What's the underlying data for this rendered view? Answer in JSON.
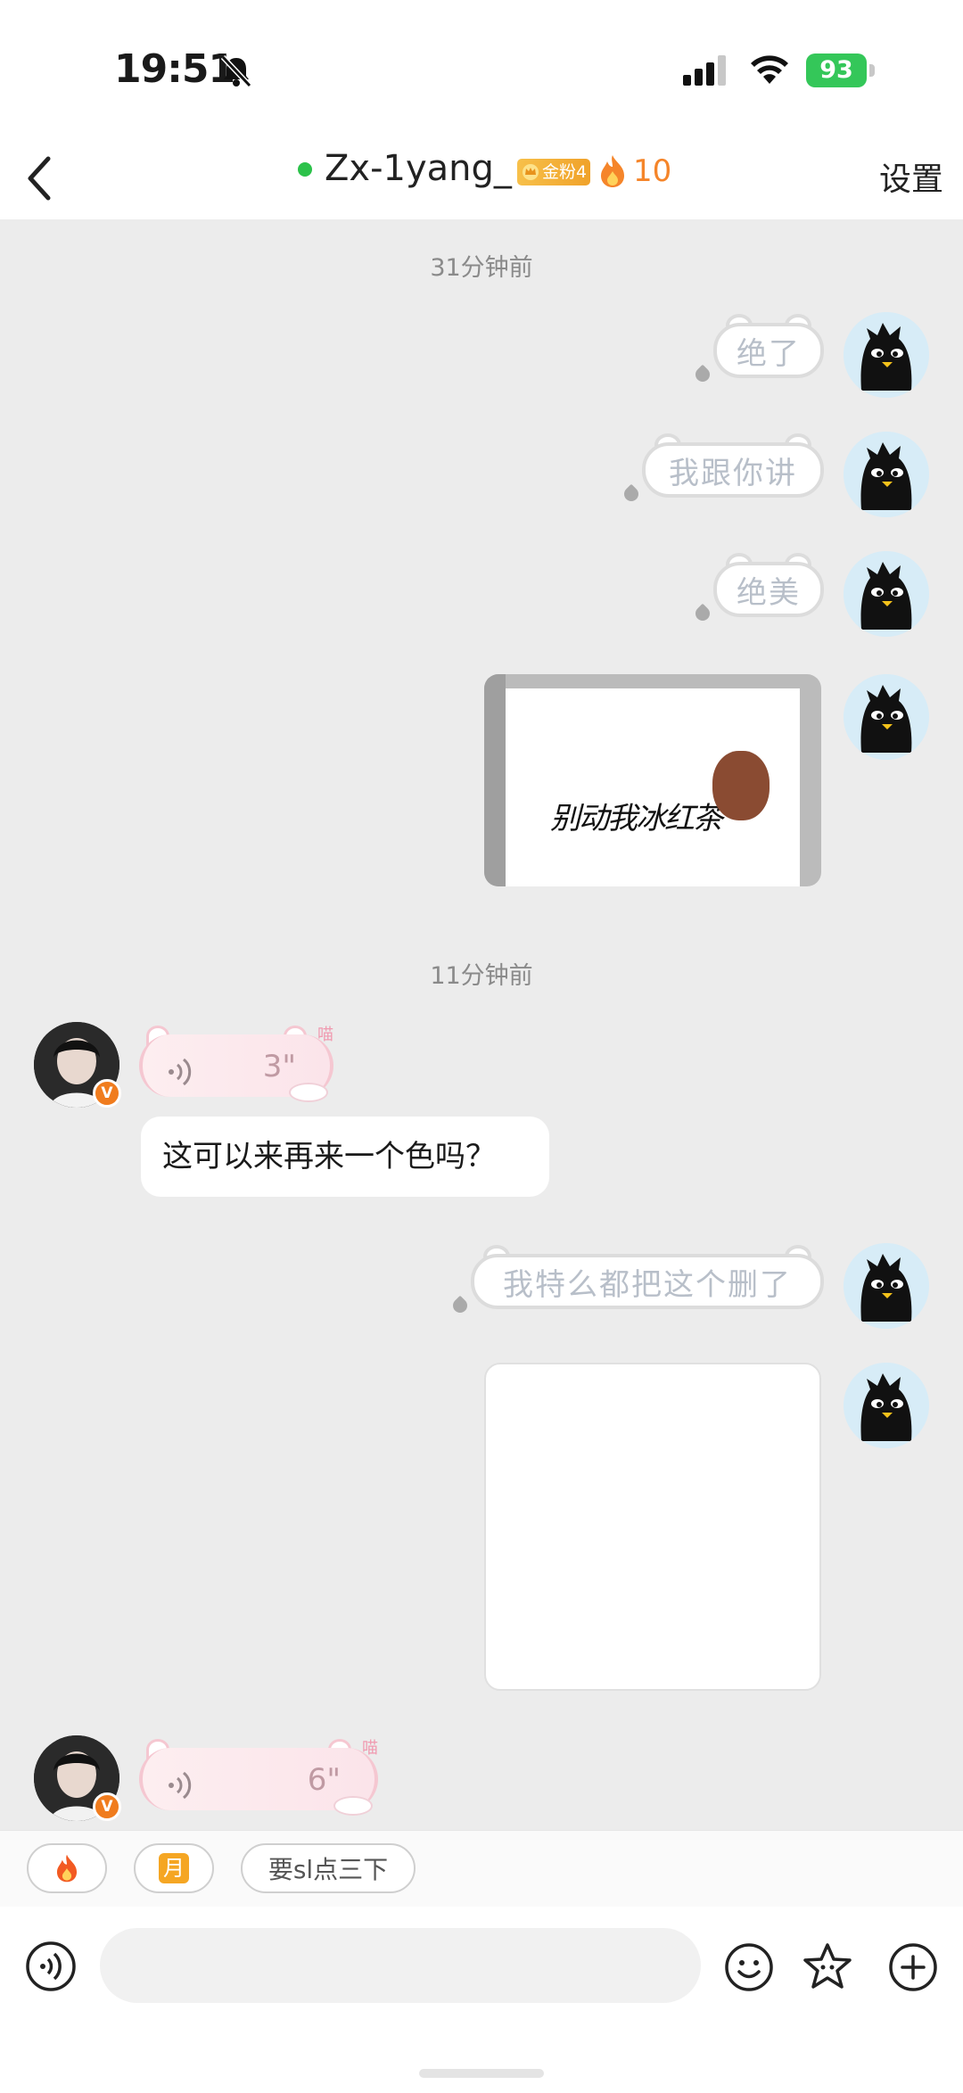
{
  "status_bar": {
    "time": "19:51",
    "battery": "93"
  },
  "header": {
    "title": "Zx-1yang_",
    "fan_badge": "金粉4",
    "fire_count": "10",
    "settings": "设置"
  },
  "chat": {
    "timestamp_1": "31分钟前",
    "msg_1": "绝了",
    "msg_2": "我跟你讲",
    "msg_3": "绝美",
    "image_text": "别动我冰红茶",
    "timestamp_2": "11分钟前",
    "voice_1_duration": "3\"",
    "voice_meow": "喵",
    "their_text": "这可以来再来一个色吗？",
    "msg_4": "我特么都把这个删了",
    "voice_2_duration": "6\"",
    "vip_mark": "V"
  },
  "quick_replies": {
    "moon": "月",
    "sl": "要sl点三下"
  },
  "input": {
    "placeholder": ""
  },
  "colors": {
    "online": "#2cc24a",
    "fire": "#f5852a",
    "battery": "#34c759"
  }
}
